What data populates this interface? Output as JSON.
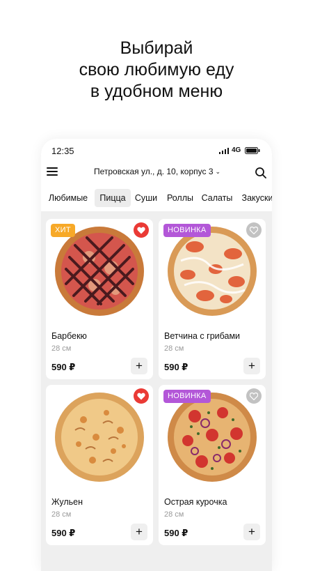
{
  "headline": {
    "line1": "Выбирай",
    "line2": "свою любимую еду",
    "line3": "в удобном меню"
  },
  "status_bar": {
    "time": "12:35",
    "network": "4G"
  },
  "topbar": {
    "address": "Петровская ул., д. 10, корпус 3",
    "address_chevron": "⌄"
  },
  "tabs": [
    {
      "label": "Любимые",
      "active": false
    },
    {
      "label": "Пицца",
      "active": true
    },
    {
      "label": "Суши",
      "active": false
    },
    {
      "label": "Роллы",
      "active": false
    },
    {
      "label": "Салаты",
      "active": false
    },
    {
      "label": "Закуски",
      "active": false
    }
  ],
  "products": [
    {
      "name": "Барбекю",
      "size": "28 см",
      "price": "590 ₽",
      "badge": "ХИТ",
      "favorite": true,
      "add_label": "+"
    },
    {
      "name": "Ветчина с грибами",
      "size": "28 см",
      "price": "590 ₽",
      "badge": "НОВИНКА",
      "favorite": false,
      "add_label": "+"
    },
    {
      "name": "Жульен",
      "size": "28 см",
      "price": "590 ₽",
      "badge": "",
      "favorite": true,
      "add_label": "+"
    },
    {
      "name": "Острая курочка",
      "size": "28 см",
      "price": "590 ₽",
      "badge": "НОВИНКА",
      "favorite": false,
      "add_label": "+"
    }
  ],
  "colors": {
    "hit_badge": "#f7a928",
    "new_badge": "#b357d8",
    "favorite_on": "#ea3a35",
    "favorite_off": "#c2c2c2",
    "screen_bg": "#efefef"
  },
  "icons": [
    "menu-icon",
    "search-icon",
    "signal-icon",
    "battery-icon",
    "heart-icon",
    "plus-icon",
    "chevron-down-icon"
  ]
}
